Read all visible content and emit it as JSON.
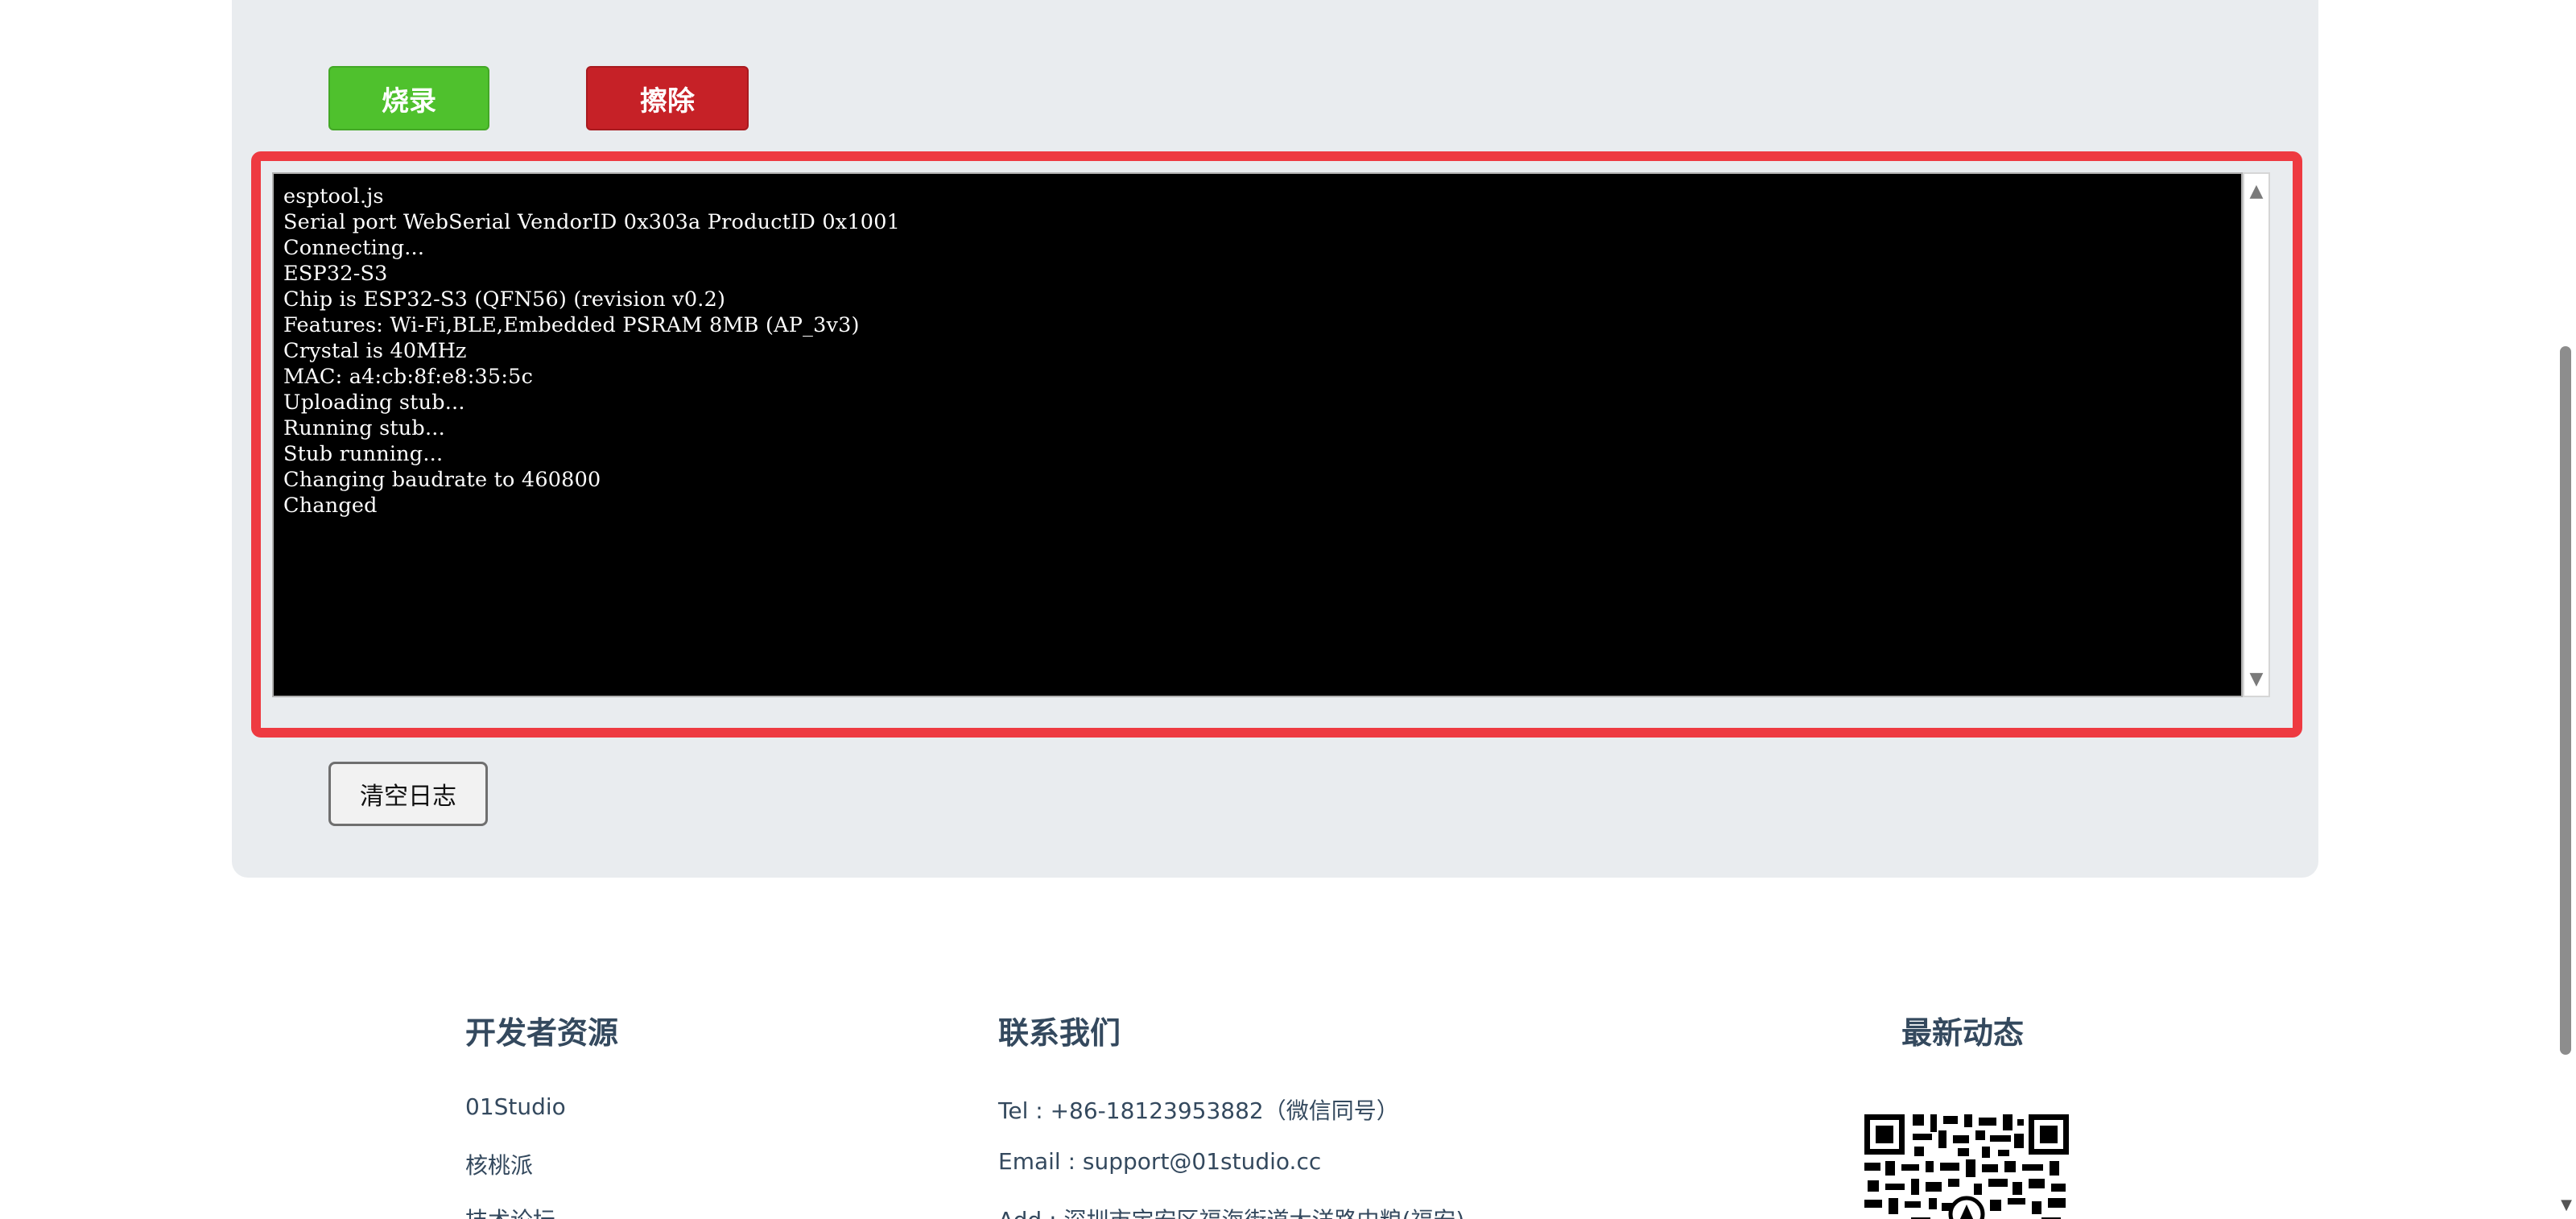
{
  "toolbar": {
    "burn_label": "烧录",
    "erase_label": "擦除",
    "clear_log_label": "清空日志"
  },
  "log": {
    "lines": [
      "esptool.js",
      "Serial port WebSerial VendorID 0x303a ProductID 0x1001",
      "Connecting...",
      "ESP32-S3",
      "Chip is ESP32-S3 (QFN56) (revision v0.2)",
      "Features: Wi-Fi,BLE,Embedded PSRAM 8MB (AP_3v3)",
      "Crystal is 40MHz",
      "MAC: a4:cb:8f:e8:35:5c",
      "Uploading stub...",
      "Running stub...",
      "Stub running...",
      "Changing baudrate to 460800",
      "Changed"
    ]
  },
  "footer": {
    "dev_resources": {
      "title": "开发者资源",
      "links": [
        "01Studio",
        "核桃派",
        "技术论坛"
      ]
    },
    "contact": {
      "title": "联系我们",
      "tel": "Tel : +86-18123953882（微信同号）",
      "email": "Email : support@01studio.cc",
      "address": "Add : 深圳市宝安区福海街道大洋路中粮(福安)"
    },
    "news": {
      "title": "最新动态",
      "qr_icon": "qr-code-icon"
    }
  },
  "colors": {
    "burn_button": "#4fc12d",
    "erase_button": "#c62127",
    "log_highlight_border": "#ee3a41",
    "footer_text": "#34495e",
    "panel_bg": "#e9ecef"
  }
}
